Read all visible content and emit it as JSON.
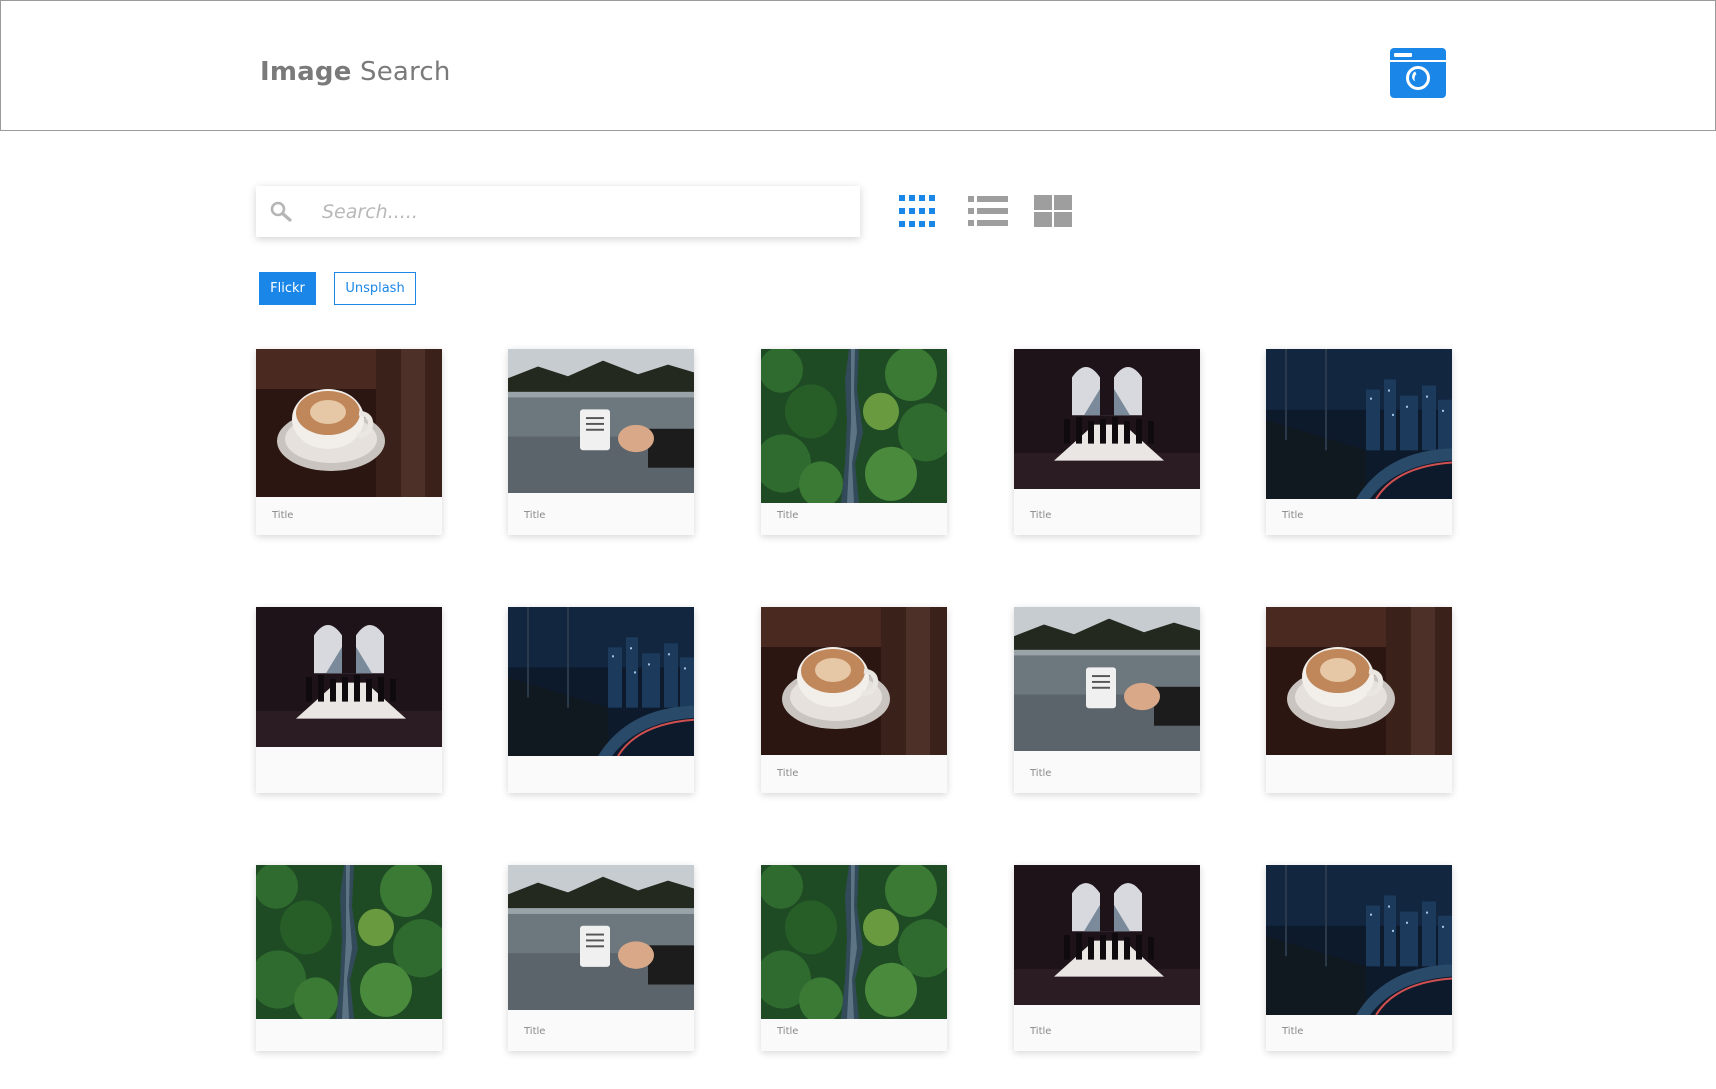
{
  "header": {
    "brand_bold": "Image",
    "brand_light": "Search",
    "camera_icon": "camera-icon",
    "accent_color": "#1a87e8"
  },
  "search": {
    "placeholder": "Search.....",
    "value": "",
    "icon": "search-icon"
  },
  "view_modes": [
    {
      "name": "grid-view",
      "icon": "dense-grid-icon",
      "active": true
    },
    {
      "name": "list-view",
      "icon": "list-icon",
      "active": false
    },
    {
      "name": "large-grid-view",
      "icon": "large-grid-icon",
      "active": false
    }
  ],
  "sources": {
    "flickr_label": "Flickr",
    "unsplash_label": "Unsplash",
    "selected": "Flickr"
  },
  "cards": [
    {
      "image": "coffee-cup",
      "title": "Title"
    },
    {
      "image": "lake-mug",
      "title": "Title"
    },
    {
      "image": "forest-river",
      "title": "Title"
    },
    {
      "image": "louvre-silhouettes",
      "title": "Title"
    },
    {
      "image": "night-city",
      "title": "Title"
    },
    {
      "image": "louvre-silhouettes",
      "title": ""
    },
    {
      "image": "night-city",
      "title": ""
    },
    {
      "image": "coffee-cup",
      "title": "Title"
    },
    {
      "image": "lake-mug",
      "title": "Title"
    },
    {
      "image": "coffee-cup",
      "title": ""
    },
    {
      "image": "forest-river",
      "title": ""
    },
    {
      "image": "lake-mug",
      "title": "Title"
    },
    {
      "image": "forest-river",
      "title": "Title"
    },
    {
      "image": "louvre-silhouettes",
      "title": "Title"
    },
    {
      "image": "night-city",
      "title": "Title"
    }
  ]
}
